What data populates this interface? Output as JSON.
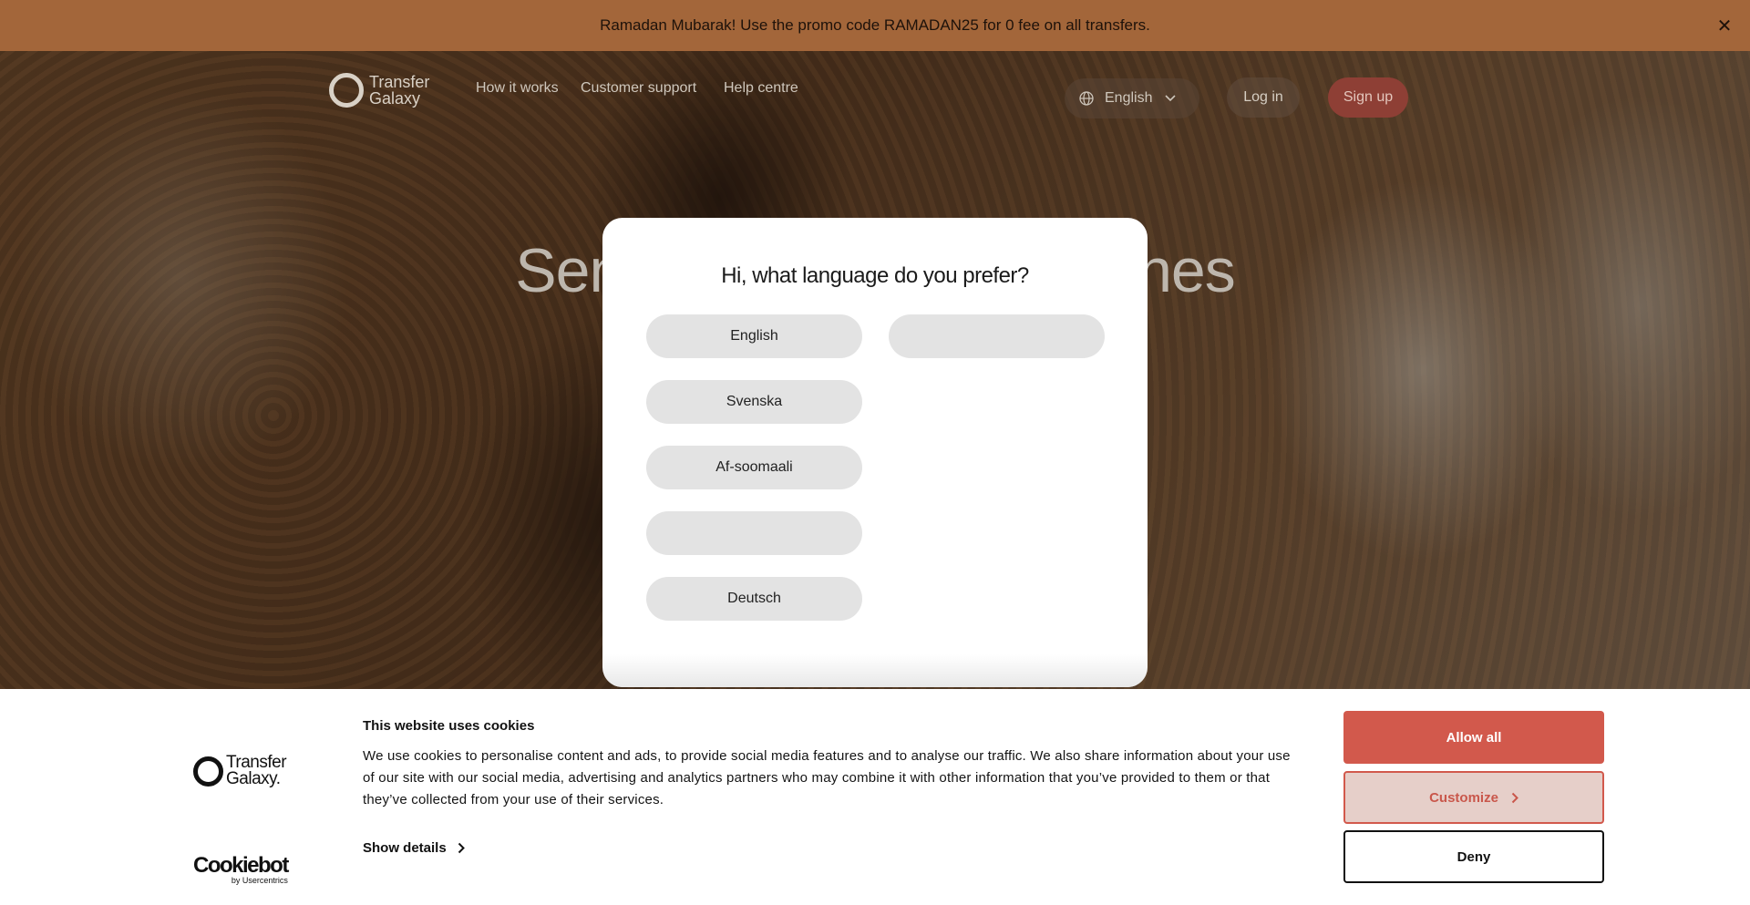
{
  "promo": {
    "text": "Ramadan Mubarak! Use the promo code RAMADAN25 for 0 fee on all transfers.",
    "close_icon": "close-icon",
    "background": "#a3663a"
  },
  "nav": {
    "logo_line1": "Transfer",
    "logo_line2": "Galaxy",
    "links": [
      "How it works",
      "Customer support",
      "Help centre"
    ],
    "language": "English",
    "login": "Log in",
    "signup": "Sign up"
  },
  "hero": {
    "title_left": "Senc",
    "title_right": "ones"
  },
  "language_modal": {
    "title": "Hi, what language do you prefer?",
    "options": [
      "English",
      "",
      "Svenska",
      "Af-soomaali",
      "",
      "Deutsch"
    ]
  },
  "cookie_banner": {
    "logo_line1": "Transfer",
    "logo_line2": "Galaxy.",
    "cookiebot": "Cookiebot",
    "cookiebot_sub": "by Usercentrics",
    "title": "This website uses cookies",
    "text": "We use cookies to personalise content and ads, to provide social media features and to analyse our traffic. We also share information about your use of our site with our social media, advertising and analytics partners who may combine it with other information that you’ve provided to them or that they’ve collected from your use of their services.",
    "show_details": "Show details",
    "allow_all": "Allow all",
    "customize": "Customize",
    "deny": "Deny",
    "accent": "#d2594c"
  }
}
